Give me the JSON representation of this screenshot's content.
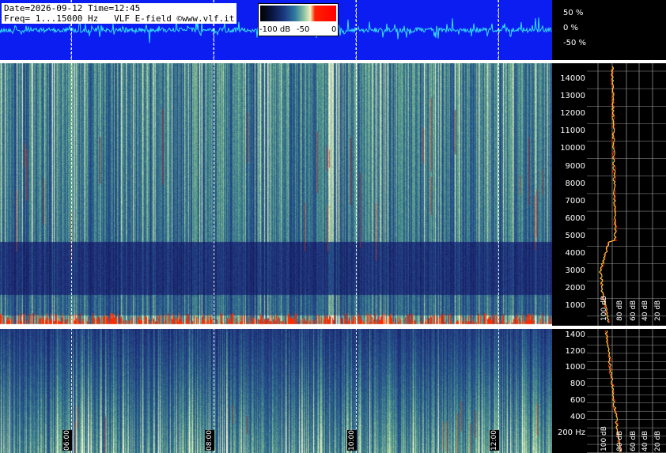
{
  "header": {
    "info_line1": "Date=2026-09-12 Time=12:45",
    "info_line2": "Freq= 1...15000 Hz   VLF E-field ©www.vlf.it"
  },
  "colorbar": {
    "labels": [
      "-100 dB",
      "-50",
      "0"
    ]
  },
  "waveform_scale": [
    "50 %",
    "0 %",
    "-50 %"
  ],
  "frequency_axis_main": [
    "14000",
    "13000",
    "12000",
    "11000",
    "10000",
    "9000",
    "8000",
    "7000",
    "6000",
    "5000",
    "4000",
    "3000",
    "2000",
    "1000"
  ],
  "frequency_axis_low": [
    "1400",
    "1200",
    "1000",
    "800",
    "600",
    "400",
    "200 Hz"
  ],
  "db_axis": [
    "100 dB",
    "80 dB",
    "60 dB",
    "40 dB",
    "20 dB"
  ],
  "time_markers": [
    "06:00",
    "08:00",
    "10:00",
    "12:00"
  ],
  "colors": {
    "waveform_bg": "#0b1df0",
    "waveform_trace": "#33e0ff",
    "spectrum_trace": "#f0e040",
    "spectrum_trace2": "#ff2000"
  }
}
